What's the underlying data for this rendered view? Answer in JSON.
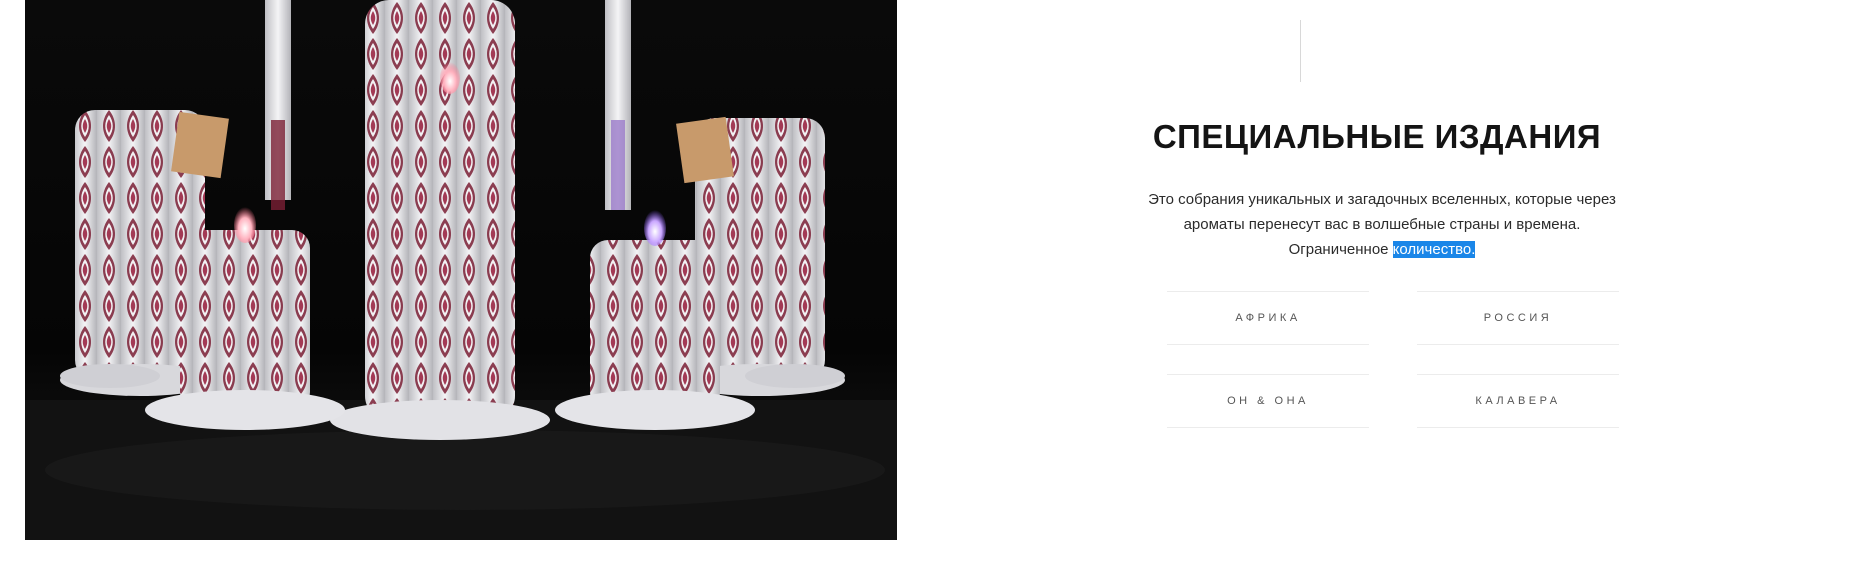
{
  "image": {
    "alt": "",
    "subject": "carved-candles-photo"
  },
  "section": {
    "title": "СПЕЦИАЛЬНЫЕ ИЗДАНИЯ",
    "description_main": "Это собрания уникальных и загадочных вселенных, которые через ароматы перенесут вас в волшебные страны и времена. Ограниченное ",
    "description_highlight": "количество."
  },
  "categories": [
    {
      "label": "АФРИКА"
    },
    {
      "label": "РОССИЯ"
    },
    {
      "label": "ОН & ОНА"
    },
    {
      "label": "КАЛАВЕРА"
    }
  ],
  "colors": {
    "highlight": "#1a86e8",
    "image_background": "#050505",
    "candle_accent": "#7a1f35"
  }
}
